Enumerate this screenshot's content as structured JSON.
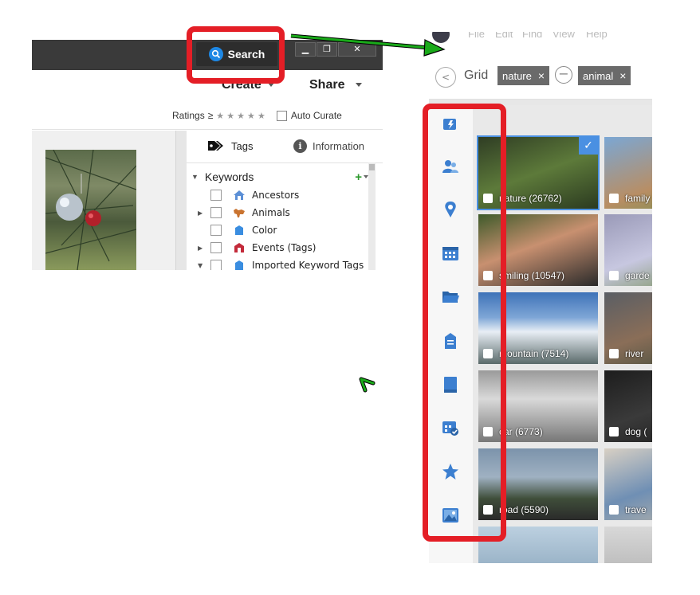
{
  "left_window": {
    "search_button": "Search",
    "window_controls": {
      "minimize": "▁",
      "restore": "❐",
      "close": "✕"
    },
    "toolbar": {
      "create": "Create",
      "share": "Share"
    },
    "ratings": {
      "label": "Ratings",
      "op": "≥",
      "stars": "★ ★ ★ ★ ★",
      "auto_curate": "Auto Curate"
    },
    "tabs": {
      "tags": "Tags",
      "information": "Information"
    },
    "keywords": {
      "header": "Keywords",
      "add": "+",
      "items": [
        {
          "label": "Ancestors",
          "icon": "house-icon",
          "color": "#5b8fd6",
          "expander": ""
        },
        {
          "label": "Animals",
          "icon": "dog-icon",
          "color": "#c9732f",
          "expander": "▶"
        },
        {
          "label": "Color",
          "icon": "tag-icon",
          "color": "#3a8de0",
          "expander": ""
        },
        {
          "label": "Events (Tags)",
          "icon": "event-icon",
          "color": "#c32a3a",
          "expander": "▶"
        },
        {
          "label": "Imported Keyword Tags",
          "icon": "tag-icon",
          "color": "#3a8de0",
          "expander": "▼"
        }
      ]
    }
  },
  "right_window": {
    "menu": [
      "File",
      "Edit",
      "Find",
      "View",
      "Help"
    ],
    "nav": {
      "back": "<",
      "view": "Grid",
      "chips": [
        {
          "label": "nature",
          "remove": "×"
        },
        {
          "label": "animal",
          "remove": "×"
        }
      ],
      "minus": "−"
    },
    "sidebar_icons": [
      "auto-curate-icon",
      "people-icon",
      "places-icon",
      "calendar-icon",
      "folder-icon",
      "keyword-tag-icon",
      "album-icon",
      "saved-search-icon",
      "star-icon",
      "media-icon"
    ],
    "tiles": [
      {
        "label": "nature (26762)",
        "bg": "linear-gradient(160deg,#2f3d24,#5d7a3a 50%,#2b3a20)",
        "selected": "✓"
      },
      {
        "label": "family",
        "bg": "linear-gradient(160deg,#7ba7d4,#b88e64 60%,#6d8e4a)"
      },
      {
        "label": "smiling (10547)",
        "bg": "linear-gradient(160deg,#3e5a2a,#c89070 45%,#2a2a2a)"
      },
      {
        "label": "garde",
        "bg": "linear-gradient(160deg,#9a9ab8,#c7c7e0 50%,#6f8a4a)"
      },
      {
        "label": "mountain (7514)",
        "bg": "linear-gradient(180deg,#3e72b8 0%,#7ea6d6 35%,#e8eef5 55%,#5a6a6a 100%)"
      },
      {
        "label": "river",
        "bg": "linear-gradient(160deg,#5a5e64,#8a6e58 50%,#3c4a3a)"
      },
      {
        "label": "car (6773)",
        "bg": "linear-gradient(180deg,#9a9a9a,#d9d9d9 40%,#777 100%)"
      },
      {
        "label": "dog (",
        "bg": "linear-gradient(160deg,#1d1d1d,#3a3a3a 50%,#191919)"
      },
      {
        "label": "road (5590)",
        "bg": "linear-gradient(180deg,#7b93ab 0%,#9fb1c2 40%,#3f4e3a 70%,#2a2a2a 100%)"
      },
      {
        "label": "trave",
        "bg": "linear-gradient(160deg,#d8d0c4,#6f8fb4 50%,#c2b8a6)"
      },
      {
        "label": "",
        "bg": "linear-gradient(180deg,#bcd0e0,#7c9ab2)"
      },
      {
        "label": "",
        "bg": "linear-gradient(180deg,#d8d8d8,#a8a8a8)"
      }
    ]
  },
  "colors": {
    "highlight": "#e41e26",
    "arrow": "#1aaa1a",
    "search_accent": "#1e88e5"
  }
}
